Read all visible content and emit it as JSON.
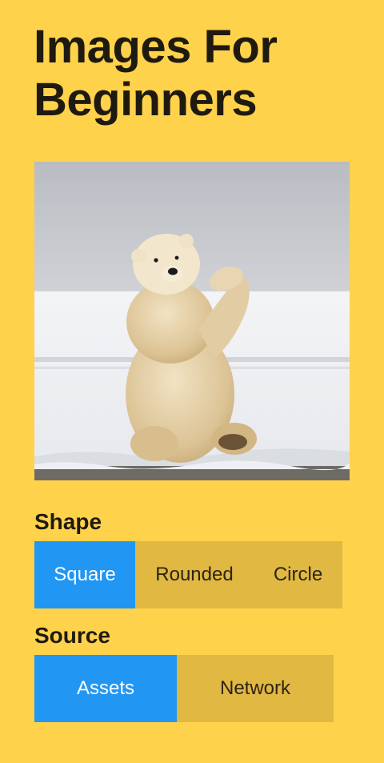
{
  "header": {
    "title_line1": "Images For",
    "title_line2": "Beginners"
  },
  "image": {
    "subject": "polar bear standing on snow",
    "icon": "polar-bear-photo"
  },
  "shape": {
    "label": "Shape",
    "options": [
      "Square",
      "Rounded",
      "Circle"
    ],
    "selected": "Square"
  },
  "source": {
    "label": "Source",
    "options": [
      "Assets",
      "Network"
    ],
    "selected": "Assets"
  },
  "colors": {
    "background": "#FFD24C",
    "segment_bg": "#E0B842",
    "accent": "#2196F3"
  }
}
